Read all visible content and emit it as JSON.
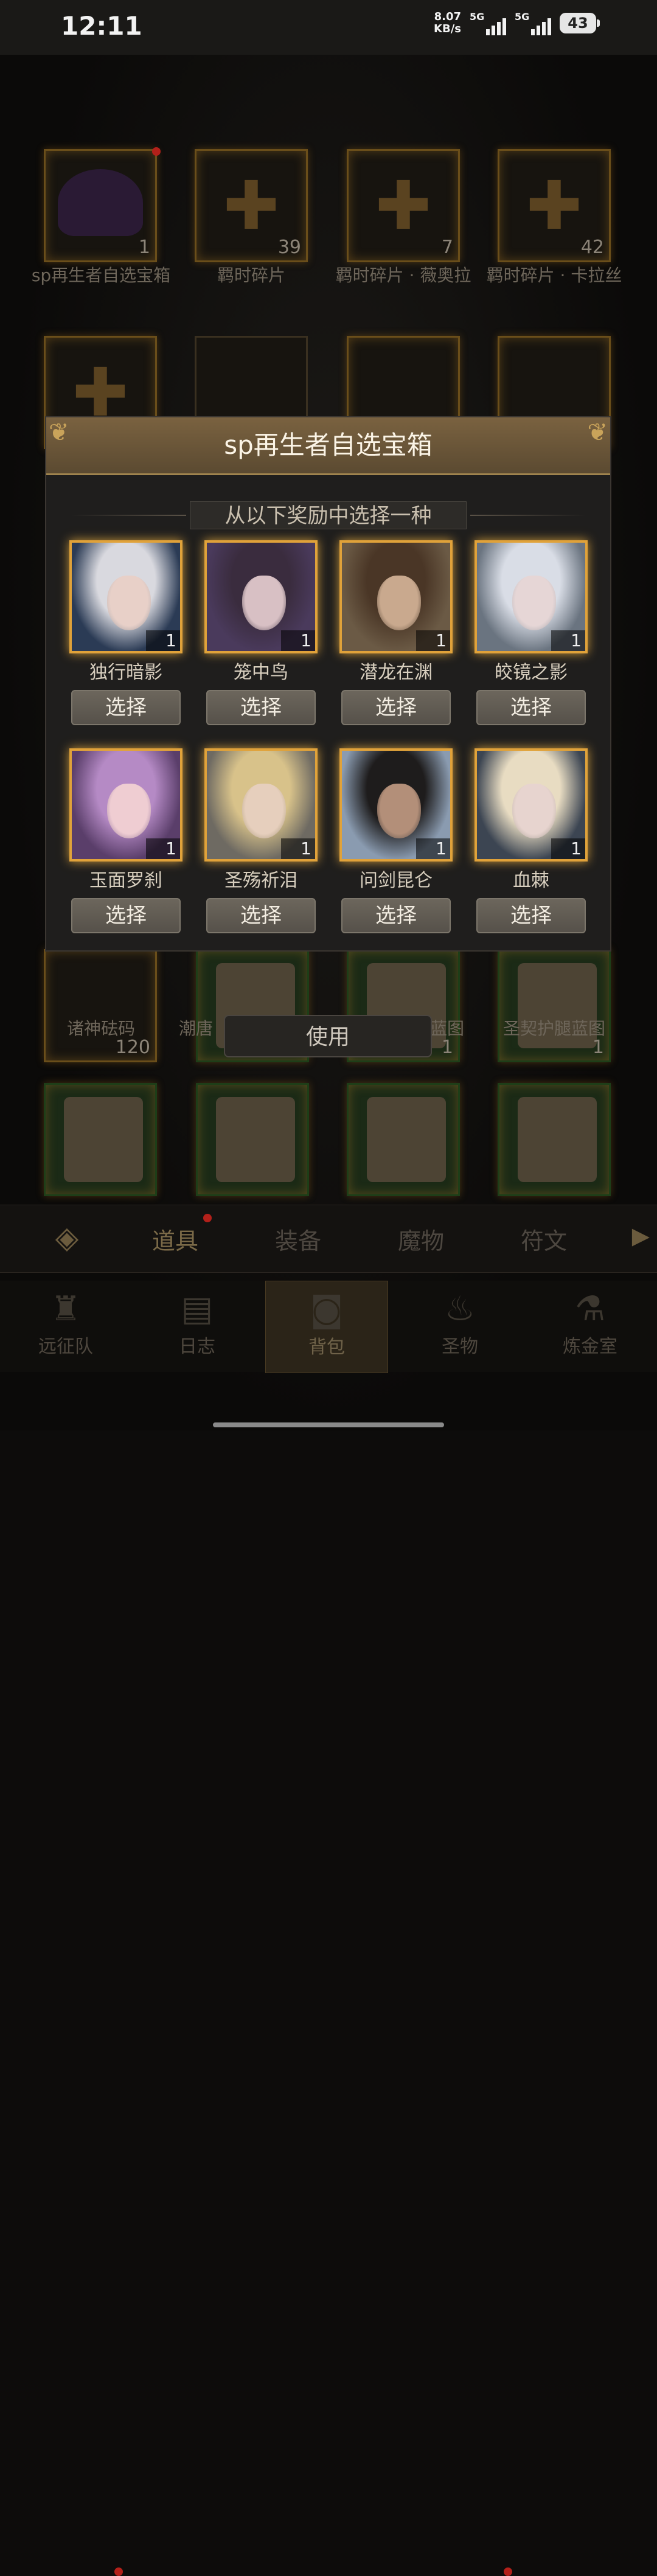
{
  "status_bar": {
    "time": "12:11",
    "speed_value": "8.07",
    "speed_unit": "KB/s",
    "sim1_label": "5G",
    "sim2_label": "5G",
    "battery": "43"
  },
  "inventory_row1": [
    {
      "label": "sp再生者自选宝箱",
      "count": "1"
    },
    {
      "label": "羁时碎片",
      "count": "39"
    },
    {
      "label": "羁时碎片 · 薇奥拉",
      "count": "7"
    },
    {
      "label": "羁时碎片 · 卡拉丝",
      "count": "42"
    }
  ],
  "inventory_row_bottom": [
    {
      "label": "诸神砝码",
      "count": "120"
    },
    {
      "label": "潮唐",
      "count": "1"
    },
    {
      "label": "蓝图",
      "count": "1"
    },
    {
      "label": "圣契护腿蓝图",
      "count": "1"
    }
  ],
  "modal": {
    "title": "sp再生者自选宝箱",
    "subtitle": "从以下奖励中选择一种",
    "select_label": "选择",
    "options": [
      {
        "name": "独行暗影",
        "qty": "1",
        "hair": "#d9d9df",
        "skin": "#e8d0c8",
        "bg": "#2b3b55"
      },
      {
        "name": "笼中鸟",
        "qty": "1",
        "hair": "#3a2c3e",
        "skin": "#d8c0c4",
        "bg": "#4a3a5c"
      },
      {
        "name": "潜龙在渊",
        "qty": "1",
        "hair": "#4a3626",
        "skin": "#c9a98e",
        "bg": "#6b5a45"
      },
      {
        "name": "皎镜之影",
        "qty": "1",
        "hair": "#d9dde6",
        "skin": "#e6d6d6",
        "bg": "#6a7480"
      },
      {
        "name": "玉面罗刹",
        "qty": "1",
        "hair": "#b58ac5",
        "skin": "#efcdd2",
        "bg": "#5a3e6a"
      },
      {
        "name": "圣殇祈泪",
        "qty": "1",
        "hair": "#d8c28a",
        "skin": "#e6cfbd",
        "bg": "#6e6a62"
      },
      {
        "name": "问剑昆仑",
        "qty": "1",
        "hair": "#1e1c1c",
        "skin": "#b38f79",
        "bg": "#8a9bb0"
      },
      {
        "name": "血棘",
        "qty": "1",
        "hair": "#e8dcc2",
        "skin": "#e7d4cf",
        "bg": "#3c4552"
      }
    ]
  },
  "use_button": "使用",
  "tabs": [
    "道具",
    "装备",
    "魔物",
    "符文"
  ],
  "nav": [
    "远征队",
    "日志",
    "背包",
    "圣物",
    "炼金室"
  ]
}
